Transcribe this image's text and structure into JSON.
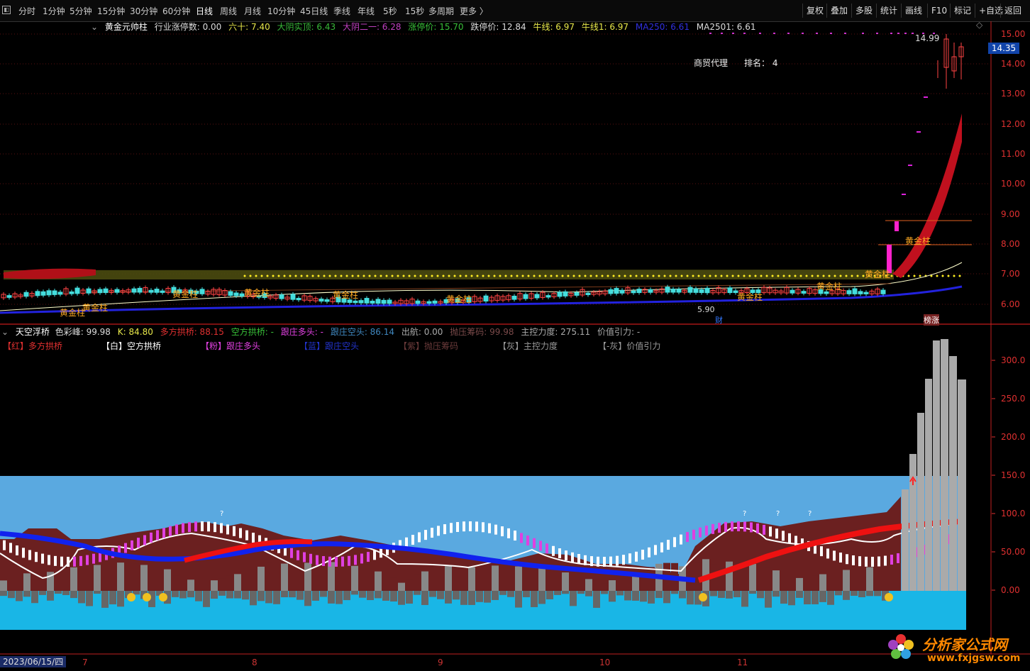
{
  "toolbar": {
    "periods": [
      "分时",
      "1分钟",
      "5分钟",
      "15分钟",
      "30分钟",
      "60分钟",
      "日线",
      "周线",
      "月线",
      "10分钟",
      "45日线",
      "季线",
      "年线",
      "5秒",
      "15秒",
      "多周期",
      "更多 〉"
    ],
    "right_buttons": [
      "复权",
      "叠加",
      "多股",
      "统计",
      "画线",
      "F10",
      "标记",
      "+自选",
      "返回"
    ]
  },
  "main_legend": {
    "indicator": "黄金元帅柱",
    "items": [
      {
        "text": "行业涨停数: 0.00",
        "color": "#dddddd"
      },
      {
        "text": "六十: 7.40",
        "color": "#e8e84a"
      },
      {
        "text": "大阴实顶: 6.43",
        "color": "#38b838"
      },
      {
        "text": "大阴二一: 6.28",
        "color": "#c040c0"
      },
      {
        "text": "涨停价: 15.70",
        "color": "#38c038"
      },
      {
        "text": "跌停价: 12.84",
        "color": "#dddddd"
      },
      {
        "text": "牛线: 6.97",
        "color": "#e8e84a"
      },
      {
        "text": "牛线1: 6.97",
        "color": "#e8e84a"
      },
      {
        "text": "MA250: 6.61",
        "color": "#3030e0"
      },
      {
        "text": "MA2501: 6.61",
        "color": "#dddddd"
      }
    ]
  },
  "main_chart": {
    "y_labels": [
      "15.00",
      "14.00",
      "13.00",
      "12.00",
      "11.00",
      "10.00",
      "9.00",
      "8.00",
      "7.00",
      "6.00"
    ],
    "current_price": "14.35",
    "high_label": "14.99",
    "low_label": "5.90",
    "industry_text": "商贸代理",
    "rank_text": "排名：  4",
    "gold_labels": [
      "黄金柱",
      "黄金柱",
      "黄金柱",
      "黄金柱",
      "黄金柱",
      "黄金柱",
      "黄金柱",
      "黄金柱",
      "黄金柱",
      "黄金柱"
    ],
    "cai_label": "财",
    "bang_label": "榜涨"
  },
  "sub_legend": {
    "indicator": "天空浮桥",
    "items": [
      {
        "text": "色彩峰: 99.98",
        "color": "#dddddd"
      },
      {
        "text": "K: 84.80",
        "color": "#e8e84a"
      },
      {
        "text": "多方拱桥: 88.15",
        "color": "#e03030"
      },
      {
        "text": "空方拱桥: -",
        "color": "#38c038"
      },
      {
        "text": "跟庄多头: -",
        "color": "#e040e0"
      },
      {
        "text": "跟庄空头: 86.14",
        "color": "#4088c0"
      },
      {
        "text": "出航: 0.00",
        "color": "#aaaaaa"
      },
      {
        "text": "抛压筹码: 99.98",
        "color": "#7a4a4a"
      },
      {
        "text": "主控力度: 275.11",
        "color": "#aaaaaa"
      },
      {
        "text": "价值引力: -",
        "color": "#aaaaaa"
      }
    ],
    "key_items": [
      {
        "text": "【红】多方拱桥",
        "color": "#e03030"
      },
      {
        "text": "【白】空方拱桥",
        "color": "#ffffff"
      },
      {
        "text": "【粉】跟庄多头",
        "color": "#e040e0"
      },
      {
        "text": "【蓝】跟庄空头",
        "color": "#2233cc"
      },
      {
        "text": "【紫】抛压筹码",
        "color": "#6a3a3a"
      },
      {
        "text": "【灰】主控力度",
        "color": "#999999"
      },
      {
        "text": "【-灰】价值引力",
        "color": "#999999"
      }
    ],
    "y_labels": [
      "300.0",
      "250.0",
      "200.0",
      "150.0",
      "100.0",
      "50.00",
      "0.00"
    ],
    "question_marks": [
      "?",
      "?",
      "?",
      "?"
    ]
  },
  "x_axis": {
    "date": "2023/06/15/四",
    "months": [
      "7",
      "8",
      "9",
      "10",
      "11"
    ]
  },
  "watermark": {
    "text": "分析家公式网",
    "url": "www.fxjgsw.com"
  },
  "colors": {
    "axis": "#e03030",
    "sky": "#5aa9e0",
    "sea": "#19b6e6",
    "maroon": "#6b2020"
  }
}
